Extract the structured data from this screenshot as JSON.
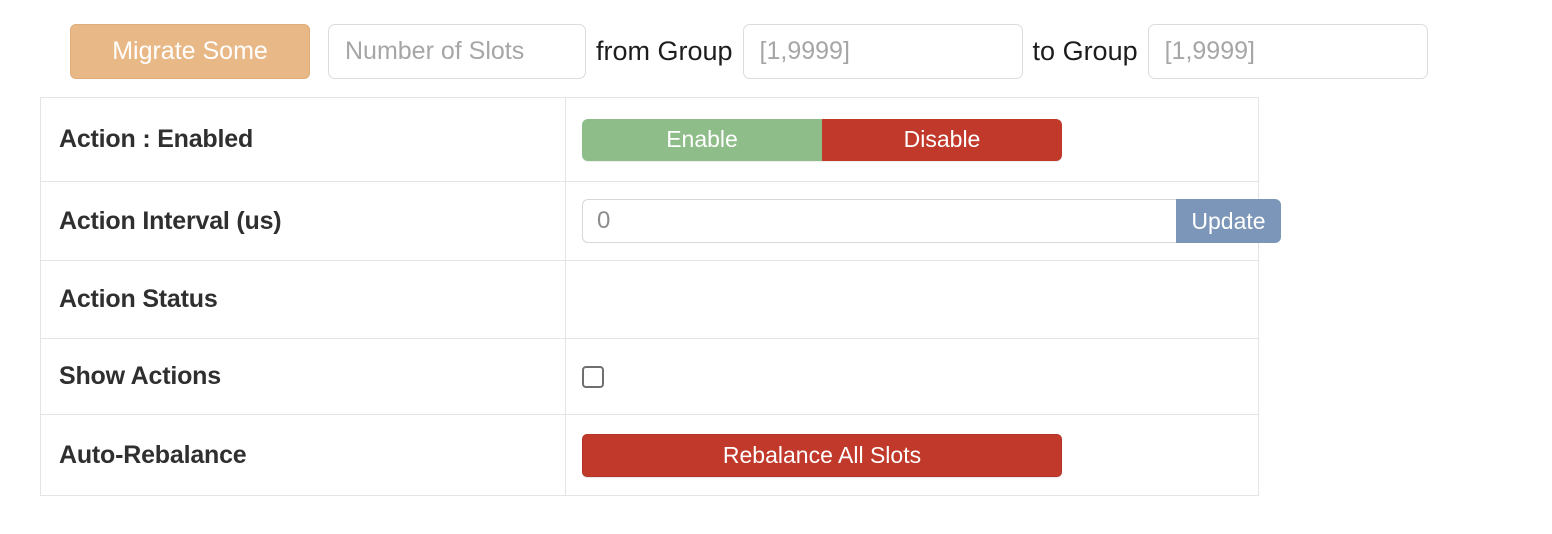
{
  "migrate_bar": {
    "migrate_button_label": "Migrate Some",
    "slots_input_value": "",
    "slots_input_placeholder": "Number of Slots",
    "from_group_label": "from Group",
    "from_group_value": "",
    "from_group_placeholder": "[1,9999]",
    "to_group_label": "to Group",
    "to_group_value": "",
    "to_group_placeholder": "[1,9999]"
  },
  "settings": {
    "rows": [
      {
        "label": "Action : Enabled",
        "enable_label": "Enable",
        "disable_label": "Disable"
      },
      {
        "label": "Action Interval (us)",
        "interval_value": "",
        "interval_placeholder": "0",
        "update_label": "Update"
      },
      {
        "label": "Action Status",
        "status_text": ""
      },
      {
        "label": "Show Actions",
        "checkbox_checked": false
      },
      {
        "label": "Auto-Rebalance",
        "rebalance_label": "Rebalance All Slots"
      }
    ]
  },
  "colors": {
    "migrate_button": "#e8b887",
    "enable_green": "#8ebd8a",
    "disable_red": "#c0392b",
    "update_blue": "#7b96b8",
    "rebalance_red": "#c0392b",
    "table_border": "#e4e4e4",
    "placeholder_gray": "#a6a6a6"
  }
}
